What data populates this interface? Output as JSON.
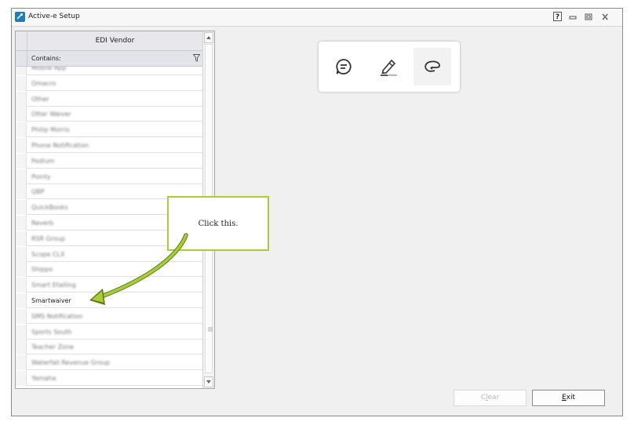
{
  "window": {
    "title": "Active-e Setup"
  },
  "grid": {
    "column_header": "EDI Vendor",
    "filter_label": "Contains:",
    "rows": [
      "Mobile App",
      "Omacro",
      "Other",
      "Otter Waiver",
      "Philip Morris",
      "Phone Notification",
      "Podium",
      "Pointy",
      "QBP",
      "QuickBooks",
      "Reverb",
      "RSR Group",
      "Scope CLX",
      "Shippo",
      "Smart Etailing",
      "Smartwaiver",
      "SMS Notification",
      "Sports South",
      "Teacher Zone",
      "Waterfall Revenue Group",
      "Yamaha"
    ],
    "highlighted_row": "Smartwaiver"
  },
  "annotation": {
    "callout_text": "Click this.",
    "accent_color": "#a9cc3a"
  },
  "toolbar": {
    "tools": [
      {
        "icon": "comment-icon"
      },
      {
        "icon": "highlighter-icon"
      },
      {
        "icon": "lasso-icon"
      }
    ]
  },
  "buttons": {
    "clear_label": "Clear",
    "exit_label": "Exit"
  }
}
